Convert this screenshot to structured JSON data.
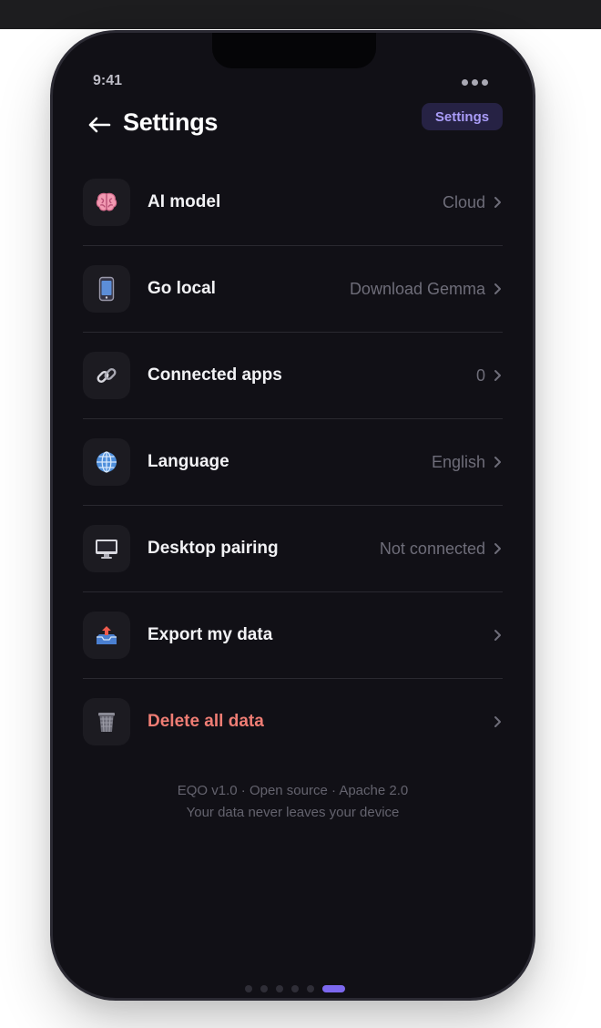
{
  "status_bar": {
    "time": "9:41"
  },
  "header": {
    "title": "Settings",
    "badge": "Settings"
  },
  "settings": [
    {
      "icon": "brain-icon",
      "emoji": "🧠",
      "label": "AI model",
      "value": "Cloud"
    },
    {
      "icon": "mobile-phone-icon",
      "emoji": "📱",
      "label": "Go local",
      "value": "Download Gemma"
    },
    {
      "icon": "link-icon",
      "emoji": "🔗",
      "label": "Connected apps",
      "value": "0"
    },
    {
      "icon": "globe-icon",
      "emoji": "🌐",
      "label": "Language",
      "value": "English"
    },
    {
      "icon": "desktop-computer-icon",
      "emoji": "🖥️",
      "label": "Desktop pairing",
      "value": "Not connected"
    },
    {
      "icon": "outbox-tray-icon",
      "emoji": "📤",
      "label": "Export my data",
      "value": ""
    },
    {
      "icon": "wastebasket-icon",
      "emoji": "🗑️",
      "label": "Delete all data",
      "value": "",
      "danger": true
    }
  ],
  "footer": {
    "line1": "EQO v1.0 · Open source · Apache 2.0",
    "line2": "Your data never leaves your device"
  },
  "pager": {
    "pages": 6,
    "current": 6
  },
  "colors": {
    "background": "#111016",
    "accent": "#7c68ef",
    "danger": "#ef7d74",
    "badge_text": "#a99cf7"
  }
}
